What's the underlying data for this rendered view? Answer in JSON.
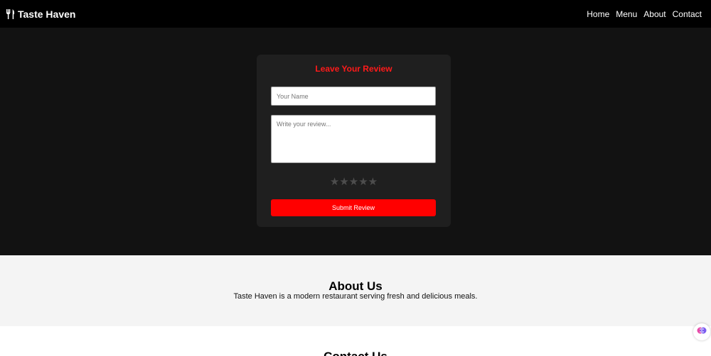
{
  "brand": {
    "name": "Taste Haven",
    "icon": "utensils-icon"
  },
  "nav": {
    "links": [
      "Home",
      "Menu",
      "About",
      "Contact"
    ]
  },
  "review_form": {
    "title": "Leave Your Review",
    "name_placeholder": "Your Name",
    "review_placeholder": "Write your review...",
    "rating": {
      "max": 5,
      "value": 0,
      "star_glyph": "★"
    },
    "submit_label": "Submit Review"
  },
  "about": {
    "title": "About Us",
    "text": "Taste Haven is a modern restaurant serving fresh and delicious meals."
  },
  "contact": {
    "title": "Contact Us"
  },
  "colors": {
    "accent": "#ff0000",
    "navbar_bg": "#000000",
    "hero_bg": "#121212",
    "card_bg": "#1f1f1f",
    "star_inactive": "#4d4d4d"
  },
  "floating_button": {
    "icon": "brain-icon"
  }
}
